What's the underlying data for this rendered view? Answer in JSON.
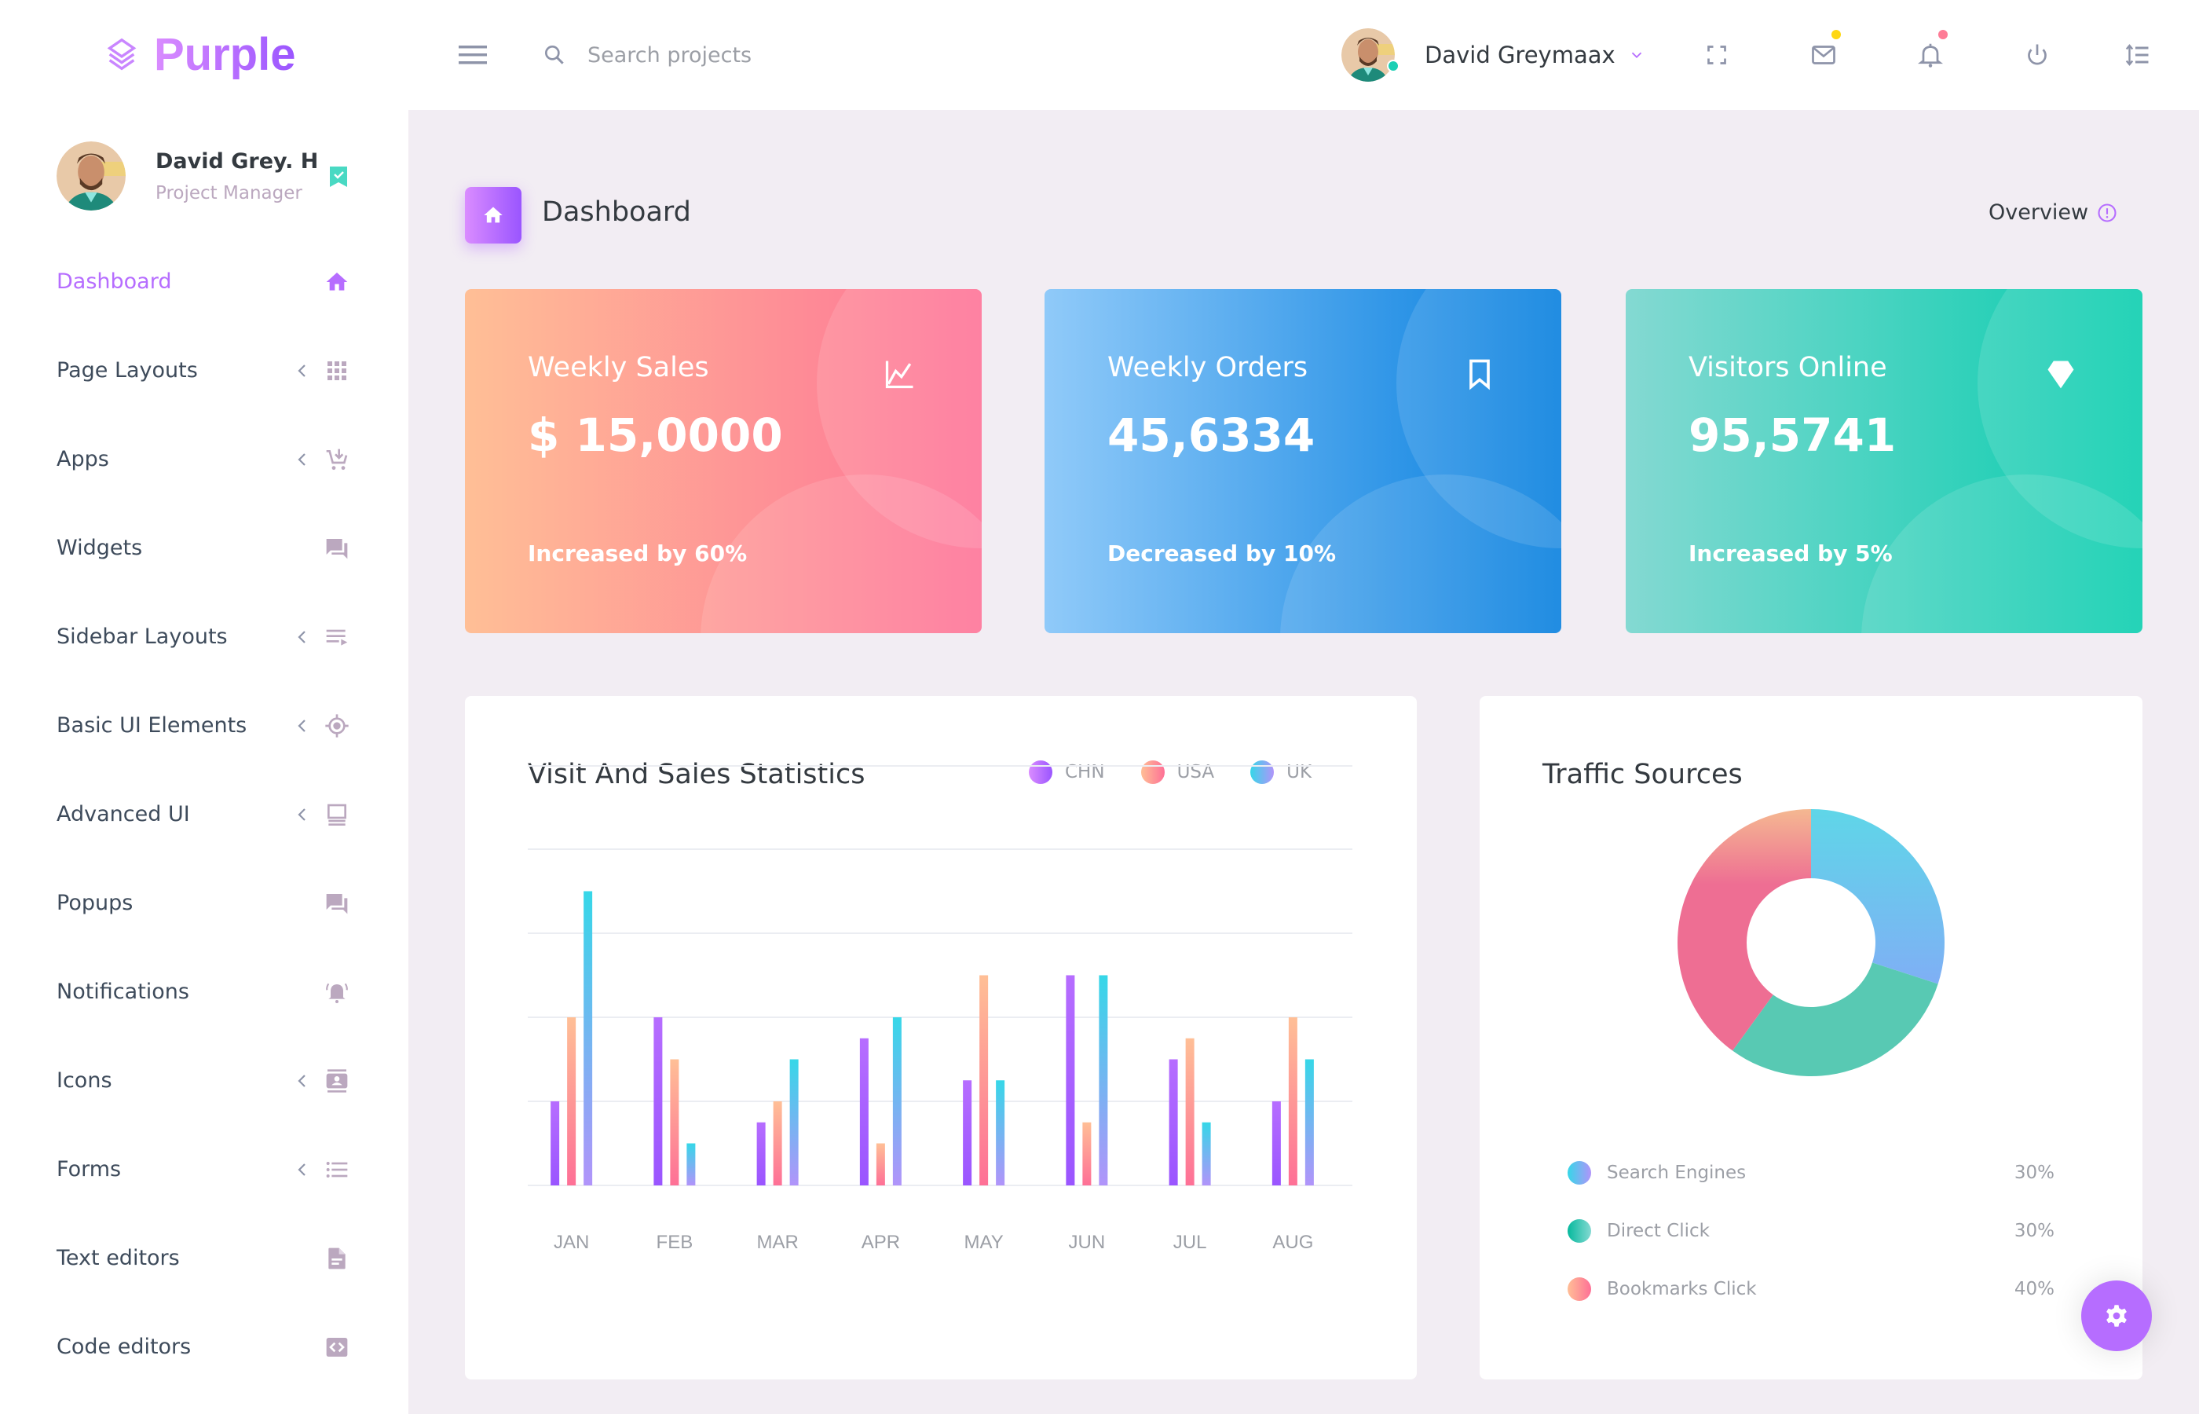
{
  "brand": {
    "name": "Purple"
  },
  "header": {
    "search_placeholder": "Search projects",
    "user_name": "David Greymaax",
    "icons": [
      "fullscreen-icon",
      "mail-icon",
      "bell-icon",
      "power-icon",
      "list-sort-icon"
    ],
    "mail_dot_color": "#fed713",
    "bell_dot_color": "#fe7c96"
  },
  "sidebar": {
    "profile": {
      "name": "David Grey. H",
      "role": "Project Manager"
    },
    "items": [
      {
        "label": "Dashboard",
        "icon": "home-icon",
        "active": true,
        "has_arrow": false
      },
      {
        "label": "Page Layouts",
        "icon": "grid-icon",
        "has_arrow": true
      },
      {
        "label": "Apps",
        "icon": "cart-arrow-down-icon",
        "has_arrow": true
      },
      {
        "label": "Widgets",
        "icon": "forum-icon",
        "has_arrow": false
      },
      {
        "label": "Sidebar Layouts",
        "icon": "playlist-play-icon",
        "has_arrow": true
      },
      {
        "label": "Basic UI Elements",
        "icon": "crosshairs-gps-icon",
        "has_arrow": true
      },
      {
        "label": "Advanced UI",
        "icon": "laptop-icon",
        "has_arrow": true
      },
      {
        "label": "Popups",
        "icon": "forum-icon",
        "has_arrow": false
      },
      {
        "label": "Notifications",
        "icon": "bell-ring-icon",
        "has_arrow": false
      },
      {
        "label": "Icons",
        "icon": "contacts-icon",
        "has_arrow": true
      },
      {
        "label": "Forms",
        "icon": "format-list-bulleted-icon",
        "has_arrow": true
      },
      {
        "label": "Text editors",
        "icon": "file-document-icon",
        "has_arrow": false
      },
      {
        "label": "Code editors",
        "icon": "code-braces-box-icon",
        "has_arrow": false
      }
    ]
  },
  "page": {
    "title": "Dashboard",
    "overview_label": "Overview"
  },
  "stats": [
    {
      "title": "Weekly Sales",
      "value": "$ 15,0000",
      "footnote": "Increased by 60%",
      "icon": "chart-line-icon"
    },
    {
      "title": "Weekly Orders",
      "value": "45,6334",
      "footnote": "Decreased by 10%",
      "icon": "bookmark-outline-icon"
    },
    {
      "title": "Visitors Online",
      "value": "95,5741",
      "footnote": "Increased by 5%",
      "icon": "diamond-icon"
    }
  ],
  "chart_data": [
    {
      "type": "bar",
      "title": "Visit And Sales Statistics",
      "categories": [
        "JAN",
        "FEB",
        "MAR",
        "APR",
        "MAY",
        "JUN",
        "JUL",
        "AUG"
      ],
      "series": [
        {
          "name": "CHN",
          "values": [
            20,
            40,
            15,
            35,
            25,
            50,
            30,
            20
          ],
          "gradient": [
            "#da8cff",
            "#9a55ff"
          ]
        },
        {
          "name": "USA",
          "values": [
            40,
            30,
            20,
            10,
            50,
            15,
            35,
            40
          ],
          "gradient": [
            "#ffbf96",
            "#fe7096"
          ]
        },
        {
          "name": "UK",
          "values": [
            70,
            10,
            30,
            40,
            25,
            50,
            15,
            30
          ],
          "gradient": [
            "#36d7e8",
            "#b194fa"
          ]
        }
      ],
      "ylim": [
        0,
        80
      ],
      "grid": true,
      "legend": "top-right",
      "xlabel": "",
      "ylabel": ""
    },
    {
      "type": "pie",
      "title": "Traffic Sources",
      "donut": true,
      "slices": [
        {
          "label": "Search Engines",
          "value": 30,
          "display": "30%",
          "gradient": [
            "#36d7e8",
            "#b194fa"
          ]
        },
        {
          "label": "Direct Click",
          "value": 30,
          "display": "30%",
          "gradient": [
            "#06b99d",
            "#84d9d2"
          ]
        },
        {
          "label": "Bookmarks Click",
          "value": 40,
          "display": "40%",
          "gradient": [
            "#ffbf96",
            "#fe7096"
          ]
        }
      ]
    }
  ],
  "colors": {
    "accent": "#b66dff",
    "background": "#f2edf3",
    "text": "#343a40",
    "muted": "#9c9fa6"
  }
}
